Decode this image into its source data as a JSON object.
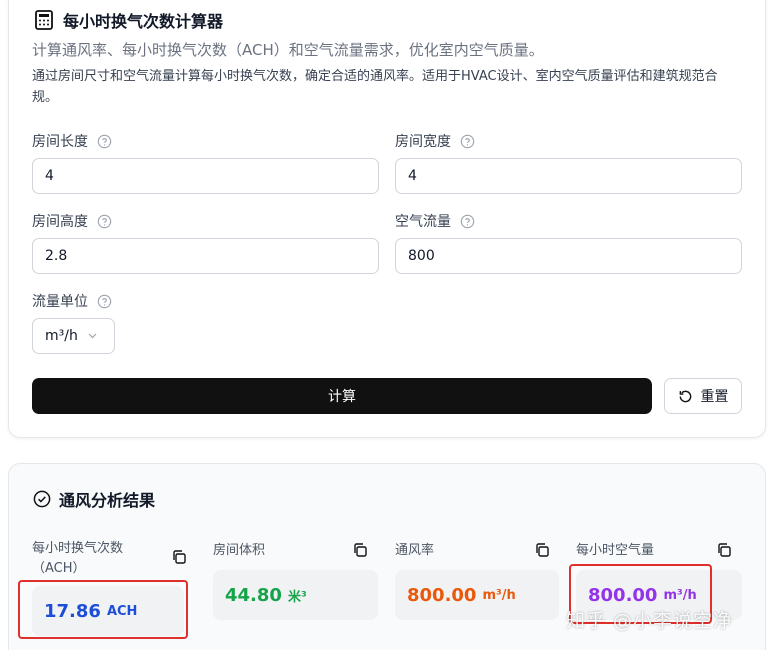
{
  "header": {
    "title": "每小时换气次数计算器",
    "subtitle": "计算通风率、每小时换气次数（ACH）和空气流量需求，优化室内空气质量。",
    "description": "通过房间尺寸和空气流量计算每小时换气次数，确定合适的通风率。适用于HVAC设计、室内空气质量评估和建筑规范合规。"
  },
  "form": {
    "length": {
      "label": "房间长度",
      "value": "4"
    },
    "width": {
      "label": "房间宽度",
      "value": "4"
    },
    "height": {
      "label": "房间高度",
      "value": "2.8"
    },
    "airflow": {
      "label": "空气流量",
      "value": "800"
    },
    "unit": {
      "label": "流量单位",
      "selected": "m³/h"
    },
    "calculate_label": "计算",
    "reset_label": "重置"
  },
  "results": {
    "title": "通风分析结果",
    "ach": {
      "label": "每小时换气次数（ACH）",
      "value": "17.86",
      "unit": "ACH",
      "color": "#1d4ed8"
    },
    "volume": {
      "label": "房间体积",
      "value": "44.80",
      "unit": "米³",
      "color": "#16a34a"
    },
    "rate": {
      "label": "通风率",
      "value": "800.00",
      "unit": "m³/h",
      "color": "#ea580c"
    },
    "hourly": {
      "label": "每小时空气量",
      "value": "800.00",
      "unit": "m³/h",
      "color": "#9333ea"
    }
  },
  "watermark": "知乎 @小李说空净",
  "colors": {
    "highlight": "#e0302b",
    "primary_button": "#111111"
  }
}
